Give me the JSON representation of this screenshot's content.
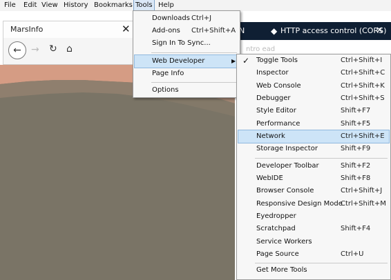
{
  "menubar": {
    "items": [
      {
        "label": "File"
      },
      {
        "label": "Edit"
      },
      {
        "label": "View"
      },
      {
        "label": "History"
      },
      {
        "label": "Bookmarks"
      },
      {
        "label": "Tools"
      },
      {
        "label": "Help"
      }
    ]
  },
  "tab": {
    "title": "MarsInfo",
    "close": "✕"
  },
  "nav": {
    "back": "←",
    "forward": "→",
    "reload": "↻",
    "home": "⌂"
  },
  "right_tabs": {
    "fragment": "N",
    "cors_label": "HTTP access control (CORS)",
    "close": "✕"
  },
  "faded_text": "ntro ead",
  "tools_menu": {
    "items": [
      {
        "label": "Downloads",
        "shortcut": "Ctrl+J"
      },
      {
        "label": "Add-ons",
        "shortcut": "Ctrl+Shift+A"
      },
      {
        "label": "Sign In To Sync..."
      },
      {
        "label": "Web Developer",
        "submenu": true
      },
      {
        "label": "Page Info"
      },
      {
        "label": "Options"
      }
    ]
  },
  "webdev_menu": {
    "items": [
      {
        "label": "Toggle Tools",
        "shortcut": "Ctrl+Shift+I",
        "checked": true
      },
      {
        "label": "Inspector",
        "shortcut": "Ctrl+Shift+C"
      },
      {
        "label": "Web Console",
        "shortcut": "Ctrl+Shift+K"
      },
      {
        "label": "Debugger",
        "shortcut": "Ctrl+Shift+S"
      },
      {
        "label": "Style Editor",
        "shortcut": "Shift+F7"
      },
      {
        "label": "Performance",
        "shortcut": "Shift+F5"
      },
      {
        "label": "Network",
        "shortcut": "Ctrl+Shift+E"
      },
      {
        "label": "Storage Inspector",
        "shortcut": "Shift+F9"
      },
      {
        "label": "Developer Toolbar",
        "shortcut": "Shift+F2"
      },
      {
        "label": "WebIDE",
        "shortcut": "Shift+F8"
      },
      {
        "label": "Browser Console",
        "shortcut": "Ctrl+Shift+J"
      },
      {
        "label": "Responsive Design Mode",
        "shortcut": "Ctrl+Shift+M"
      },
      {
        "label": "Eyedropper"
      },
      {
        "label": "Scratchpad",
        "shortcut": "Shift+F4"
      },
      {
        "label": "Service Workers"
      },
      {
        "label": "Page Source",
        "shortcut": "Ctrl+U"
      },
      {
        "label": "Get More Tools"
      }
    ]
  },
  "colors": {
    "sky": "#d59c84",
    "dune": "#7a7466",
    "tab_strip": "#0f1f33",
    "menu_highlight": "#cde4f7"
  }
}
